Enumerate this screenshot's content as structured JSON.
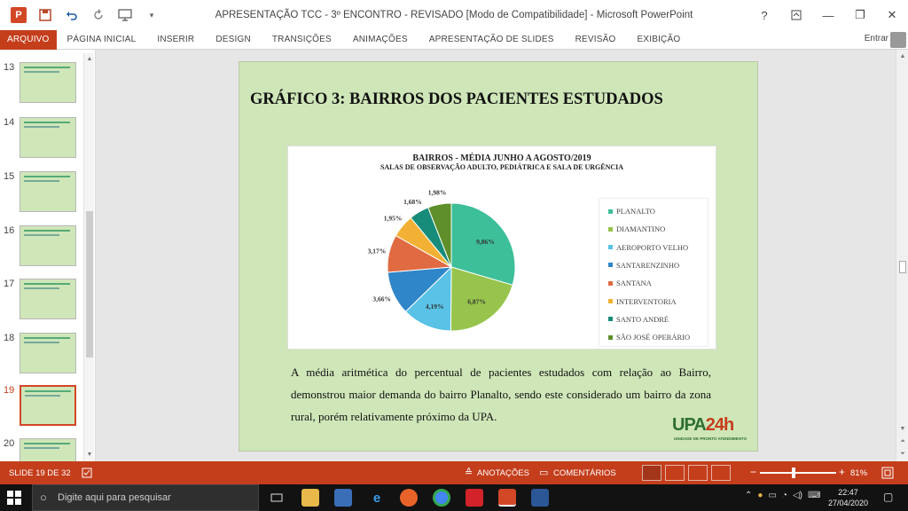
{
  "window": {
    "title": "APRESENTAÇÃO TCC - 3º ENCONTRO - REVISADO [Modo de Compatibilidade] - Microsoft PowerPoint",
    "help": "?",
    "minimize": "—",
    "restore": "❐",
    "close": "✕",
    "app_icon": "P"
  },
  "ribbon": {
    "tabs": [
      "ARQUIVO",
      "PÁGINA INICIAL",
      "INSERIR",
      "DESIGN",
      "TRANSIÇÕES",
      "ANIMAÇÕES",
      "APRESENTAÇÃO DE SLIDES",
      "REVISÃO",
      "EXIBIÇÃO"
    ],
    "signin": "Entrar"
  },
  "thumbnails": {
    "numbers": [
      "13",
      "14",
      "15",
      "16",
      "17",
      "18",
      "19",
      "20"
    ],
    "active": "19"
  },
  "slide": {
    "title": "GRÁFICO 3: BAIRROS DOS PACIENTES ESTUDADOS",
    "body": "A média aritmética do percentual de pacientes estudados com relação ao Bairro, demonstrou maior demanda do bairro Planalto, sendo este considerado um bairro da zona rural, porém relativamente próximo da UPA.",
    "logo_main_a": "UPA",
    "logo_main_b": "24h",
    "logo_sub": "UNIDADE DE PRONTO ATENDIMENTO"
  },
  "chart_data": {
    "type": "pie",
    "title": "BAIRROS - MÉDIA  JUNHO A AGOSTO/2019",
    "subtitle": "SALAS DE OBSERVAÇÃO ADULTO, PEDIÁTRICA E SALA DE URGÊNCIA",
    "categories": [
      "PLANALTO",
      "DIAMANTINO",
      "AEROPORTO VELHO",
      "SANTARENZINHO",
      "SANTANA",
      "INTERVENTORIA",
      "SANTO ANDRÉ",
      "SÃO JOSÉ OPERÁRIO"
    ],
    "values": [
      9.86,
      6.87,
      4.19,
      3.66,
      3.17,
      1.95,
      1.68,
      1.98
    ],
    "data_labels": [
      "9,86%",
      "6,87%",
      "4,19%",
      "3,66%",
      "3,17%",
      "1,95%",
      "1,68%",
      "1,98%"
    ],
    "colors": [
      "#3dbf99",
      "#97c44c",
      "#59c2e6",
      "#2f86c8",
      "#e06a42",
      "#f2b134",
      "#178c7a",
      "#5e8f2a"
    ],
    "legend_position": "right"
  },
  "status": {
    "slide_count": "SLIDE 19 DE 32",
    "notes": "ANOTAÇÕES",
    "comments": "COMENTÁRIOS",
    "zoom": "81%"
  },
  "taskbar": {
    "search_placeholder": "Digite aqui para pesquisar",
    "time": "22:47",
    "date": "27/04/2020"
  }
}
